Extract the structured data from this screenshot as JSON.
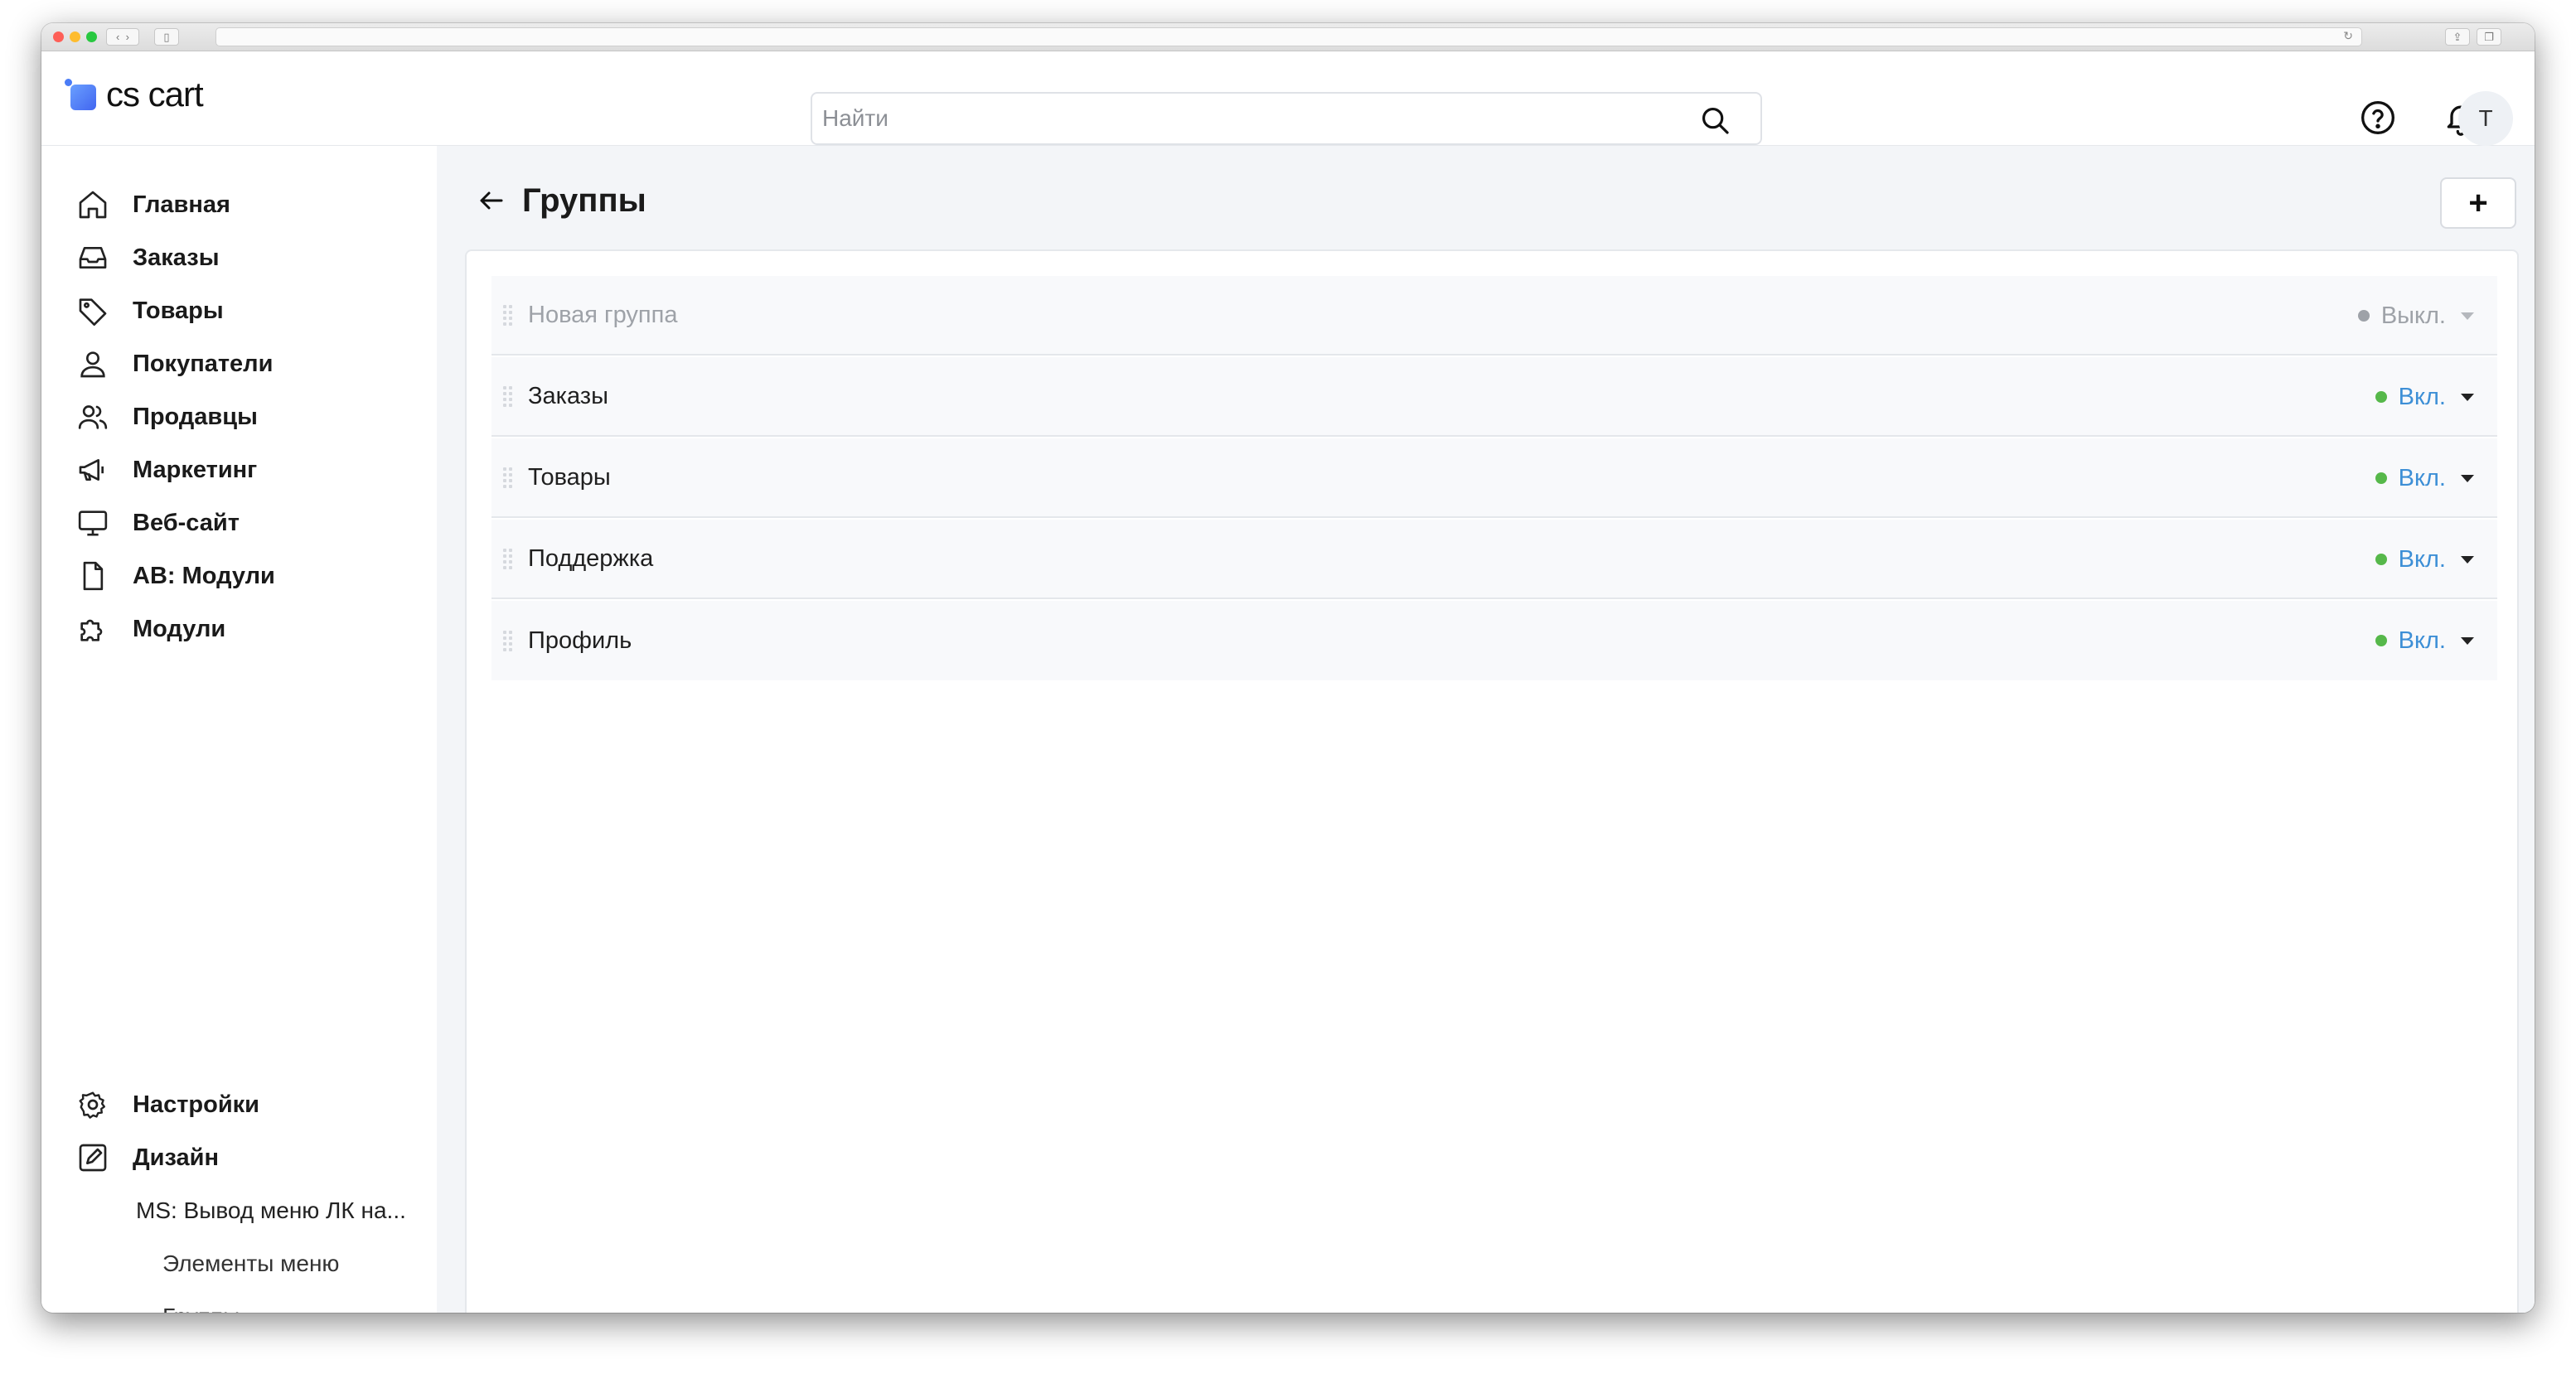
{
  "colors": {
    "accent": "#4a7cf6",
    "status_on": "#56b84a",
    "status_on_text": "#3d8fd6",
    "status_off": "#9ea2a8",
    "panel_bg": "#f3f5f8"
  },
  "header": {
    "logo_text": "cs cart",
    "search_placeholder": "Найти",
    "help_icon": "question-circle-icon",
    "notifications_icon": "bell-icon",
    "avatar_initial": "T"
  },
  "sidebar": {
    "items": [
      {
        "label": "Главная",
        "icon": "home-icon"
      },
      {
        "label": "Заказы",
        "icon": "inbox-icon"
      },
      {
        "label": "Товары",
        "icon": "tag-icon"
      },
      {
        "label": "Покупатели",
        "icon": "user-icon"
      },
      {
        "label": "Продавцы",
        "icon": "users-icon"
      },
      {
        "label": "Маркетинг",
        "icon": "megaphone-icon"
      },
      {
        "label": "Веб-сайт",
        "icon": "monitor-icon"
      },
      {
        "label": "AB: Модули",
        "icon": "file-icon"
      },
      {
        "label": "Модули",
        "icon": "puzzle-icon"
      }
    ],
    "bottom_items": [
      {
        "label": "Настройки",
        "icon": "gear-icon"
      },
      {
        "label": "Дизайн",
        "icon": "edit-icon"
      }
    ],
    "sub_items": {
      "parent": "MS: Вывод меню ЛК на...",
      "children": [
        "Элементы меню",
        "Группы"
      ],
      "active": "Группы"
    }
  },
  "main": {
    "title": "Группы",
    "add_label": "+",
    "groups": [
      {
        "name": "Новая группа",
        "status": "Выкл.",
        "enabled": false
      },
      {
        "name": "Заказы",
        "status": "Вкл.",
        "enabled": true
      },
      {
        "name": "Товары",
        "status": "Вкл.",
        "enabled": true
      },
      {
        "name": "Поддержка",
        "status": "Вкл.",
        "enabled": true
      },
      {
        "name": "Профиль",
        "status": "Вкл.",
        "enabled": true
      }
    ]
  }
}
